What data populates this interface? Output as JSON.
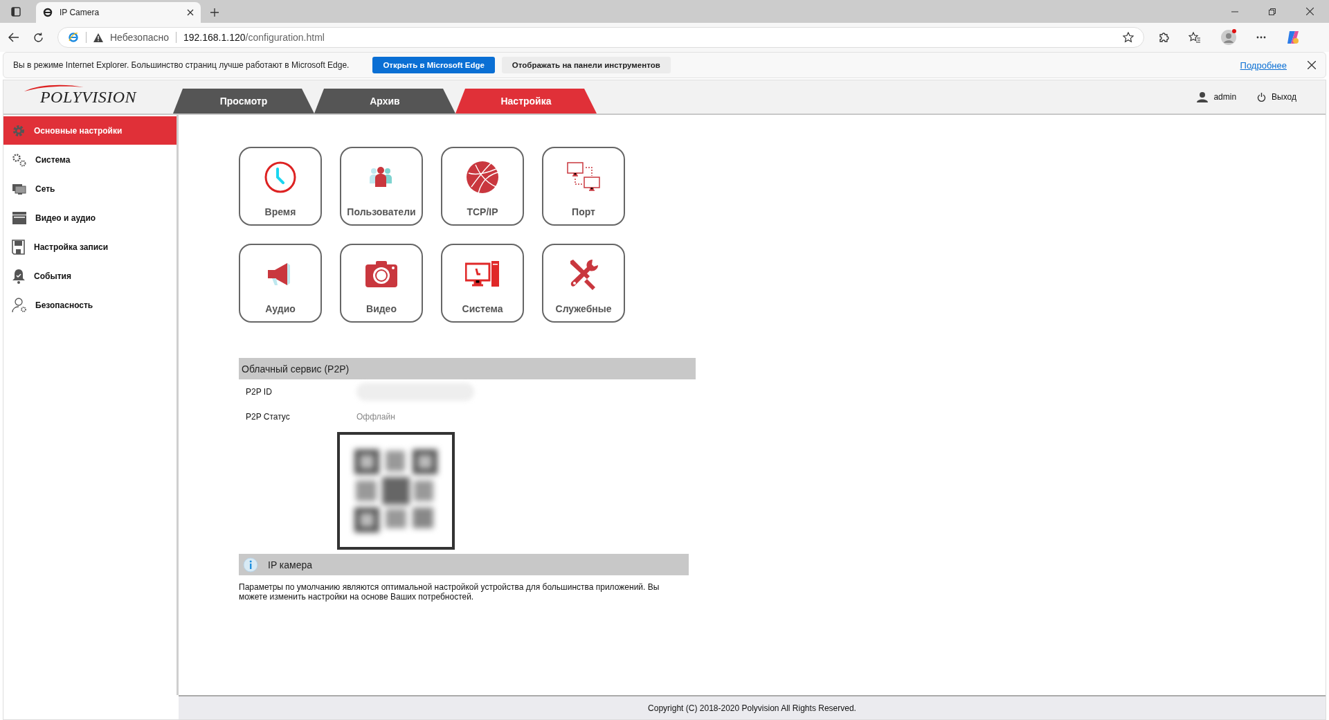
{
  "browser": {
    "tab_title": "IP Camera",
    "security_label": "Небезопасно",
    "url_host": "192.168.1.120",
    "url_path": "/configuration.html",
    "infobar": {
      "message": "Вы в режиме Internet Explorer. Большинство страниц лучше работают в Microsoft Edge.",
      "buttons": [
        {
          "label": "Открыть в Microsoft Edge",
          "kind": "primary"
        },
        {
          "label": "Отображать на панели инструментов",
          "kind": "secondary"
        }
      ],
      "link": "Подробнее"
    }
  },
  "header": {
    "logo": "POLYVISION",
    "nav_tabs": [
      {
        "label": "Просмотр",
        "selected": false
      },
      {
        "label": "Архив",
        "selected": false
      },
      {
        "label": "Настройка",
        "selected": true
      }
    ],
    "user": "admin",
    "logout": "Выход"
  },
  "sidebar": {
    "items": [
      {
        "label": "Основные настройки",
        "selected": true
      },
      {
        "label": "Система",
        "selected": false
      },
      {
        "label": "Сеть",
        "selected": false
      },
      {
        "label": "Видео и аудио",
        "selected": false
      },
      {
        "label": "Настройка записи",
        "selected": false
      },
      {
        "label": "События",
        "selected": false
      },
      {
        "label": "Безопасность",
        "selected": false
      }
    ]
  },
  "tiles": [
    {
      "label": "Время"
    },
    {
      "label": "Пользователи"
    },
    {
      "label": "TCP/IP"
    },
    {
      "label": "Порт"
    },
    {
      "label": "Аудио"
    },
    {
      "label": "Видео"
    },
    {
      "label": "Система"
    },
    {
      "label": "Служебные"
    }
  ],
  "p2p": {
    "title": "Облачный сервис (P2P)",
    "rows": [
      {
        "label": "P2P ID",
        "kind": "redacted"
      },
      {
        "label": "P2P Статус",
        "value": "Оффлайн",
        "kind": "text"
      }
    ]
  },
  "info": {
    "title": "IP камера",
    "text": "Параметры по умолчанию являются оптимальной настройкой устройства для большинства приложений. Вы можете изменить настройки на основе Ваших потребностей."
  },
  "footer": "Copyright (C) 2018-2020 Polyvision All Rights Reserved."
}
